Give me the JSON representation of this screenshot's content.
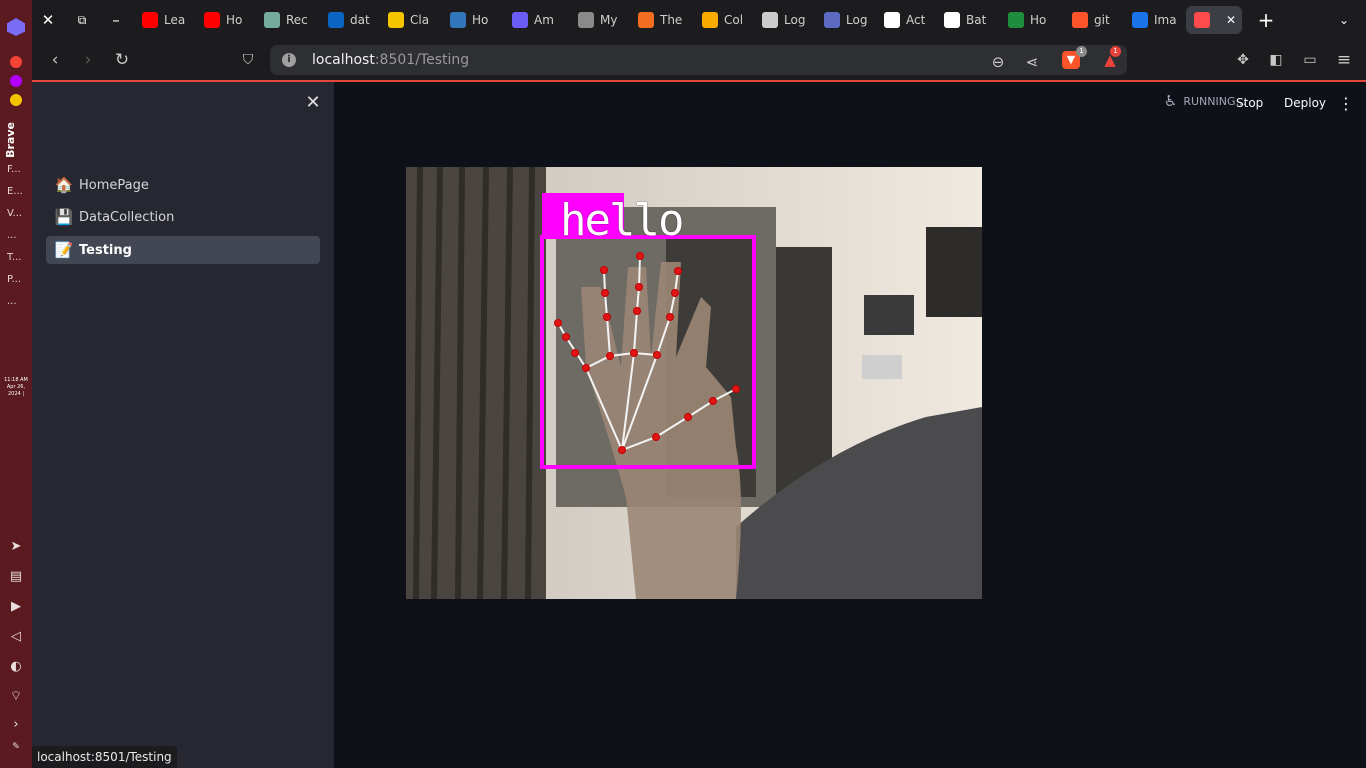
{
  "os": {
    "vertical_title": "Brave",
    "items": [
      "F...",
      "E...",
      "V...",
      "...",
      "T...",
      "P...",
      "..."
    ],
    "clock": {
      "time": "11:18 AM",
      "date": "Apr 26,",
      "year": "2024 |"
    }
  },
  "tabs": [
    {
      "label": "Lea",
      "icon": "youtube-icon",
      "color": "#ff0000"
    },
    {
      "label": "Ho",
      "icon": "youtube-icon",
      "color": "#ff0000"
    },
    {
      "label": "Rec",
      "icon": "chatgpt-icon",
      "color": "#74aa9c"
    },
    {
      "label": "dat",
      "icon": "linkedin-icon",
      "color": "#0a66c2"
    },
    {
      "label": "Cla",
      "icon": "s-icon",
      "color": "#f5c400"
    },
    {
      "label": "Ho",
      "icon": "edge-icon",
      "color": "#3277bc"
    },
    {
      "label": "Am",
      "icon": "app-icon",
      "color": "#6b5cf5"
    },
    {
      "label": "My",
      "icon": "globe-icon",
      "color": "#8a8a8a"
    },
    {
      "label": "The",
      "icon": "hackerrank-icon",
      "color": "#f26c22"
    },
    {
      "label": "Col",
      "icon": "colab-icon",
      "color": "#f9ab00"
    },
    {
      "label": "Log",
      "icon": "bird-icon",
      "color": "#cccccc"
    },
    {
      "label": "Log",
      "icon": "app-icon",
      "color": "#5c6bc0"
    },
    {
      "label": "Act",
      "icon": "github-icon",
      "color": "#ffffff"
    },
    {
      "label": "Bat",
      "icon": "github-icon",
      "color": "#ffffff"
    },
    {
      "label": "Ho",
      "icon": "sheet-icon",
      "color": "#1e8e3e"
    },
    {
      "label": "git",
      "icon": "brave-icon",
      "color": "#fb542b"
    },
    {
      "label": "Ima",
      "icon": "tm-icon",
      "color": "#1a73e8"
    },
    {
      "label": "",
      "icon": "streamlit-icon",
      "color": "#ff4b4b",
      "active": true
    }
  ],
  "url": {
    "host": "localhost",
    "path": ":8501/Testing"
  },
  "badges": {
    "shields": "1",
    "rewards": "1"
  },
  "sidebar": {
    "items": [
      {
        "emoji": "🏠",
        "label": "HomePage"
      },
      {
        "emoji": "💾",
        "label": "DataCollection"
      },
      {
        "emoji": "📝",
        "label": "Testing",
        "active": true
      }
    ]
  },
  "header": {
    "status": "RUNNING...",
    "stop": "Stop",
    "deploy": "Deploy",
    "menu": "⋮"
  },
  "video": {
    "prediction": "hello"
  },
  "statusbar": {
    "url": "localhost:8501/Testing"
  }
}
